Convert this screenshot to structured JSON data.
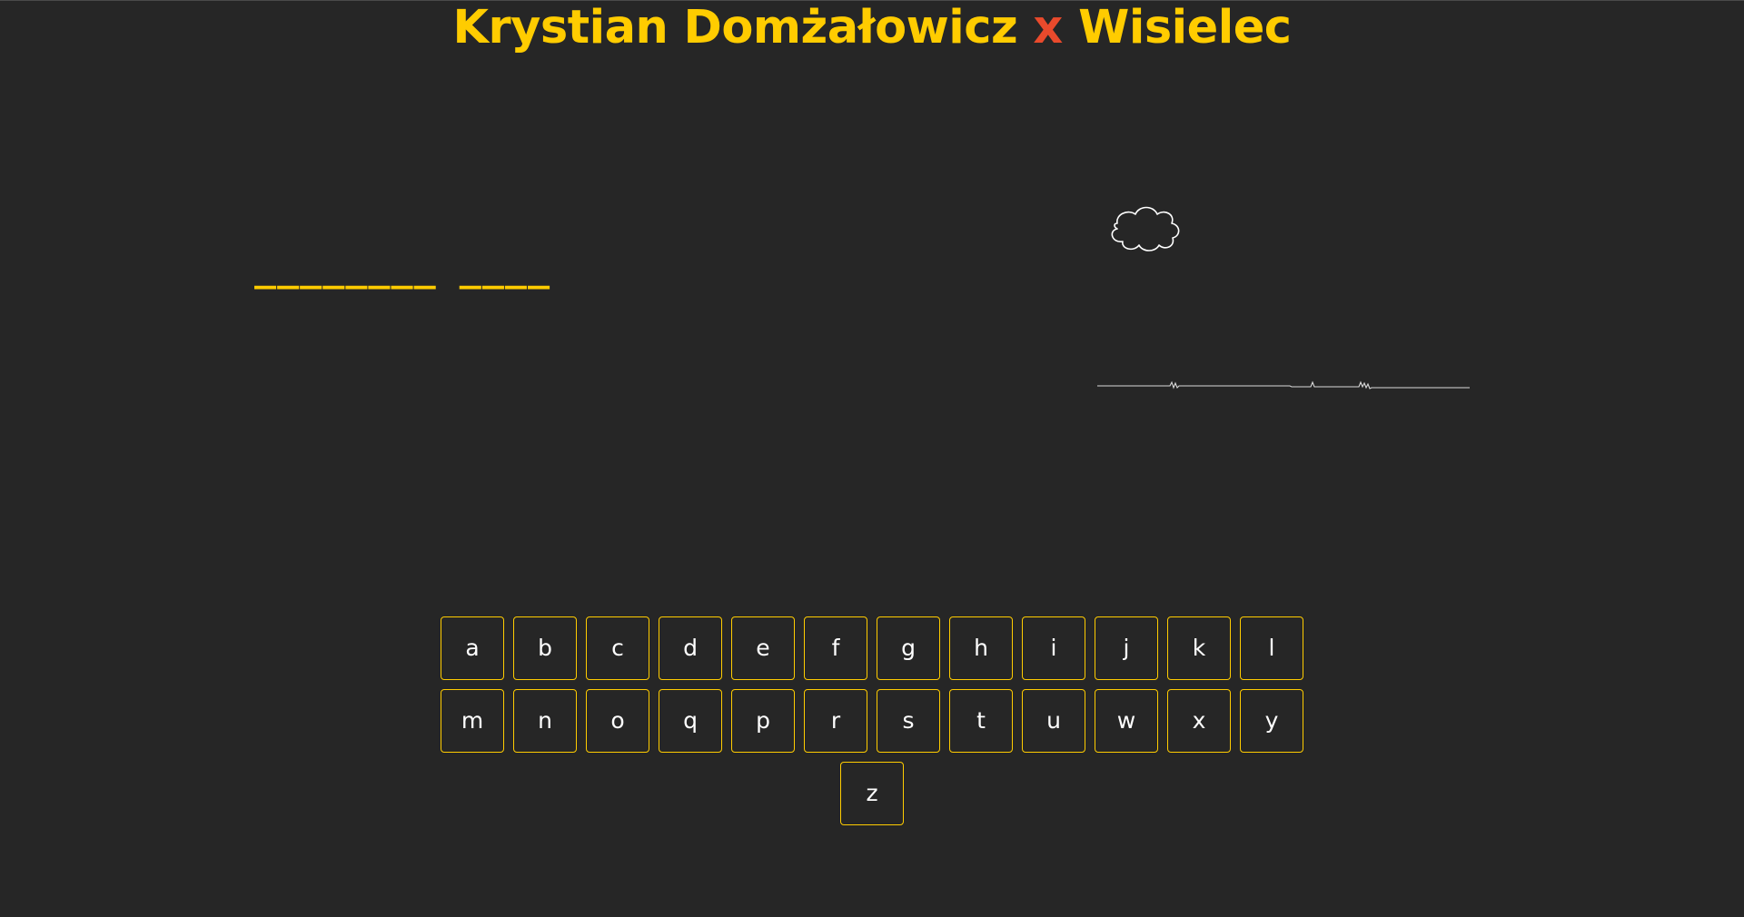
{
  "header": {
    "title_left": "Krystian Domżałowicz",
    "title_sep": "x",
    "title_right": "Wisielec"
  },
  "game": {
    "masked_word": "________ ____"
  },
  "keyboard": {
    "rows": [
      [
        "a",
        "b",
        "c",
        "d",
        "e",
        "f",
        "g",
        "h",
        "i",
        "j",
        "k",
        "l"
      ],
      [
        "m",
        "n",
        "o",
        "q",
        "p",
        "r",
        "s",
        "t",
        "u",
        "w",
        "x",
        "y"
      ],
      [
        "z"
      ]
    ]
  },
  "colors": {
    "background": "#262626",
    "accent": "#ffcc00",
    "separator": "#e94a2c",
    "key_text": "#ffffff"
  },
  "icons": [
    "cloud-icon",
    "ground-line"
  ]
}
